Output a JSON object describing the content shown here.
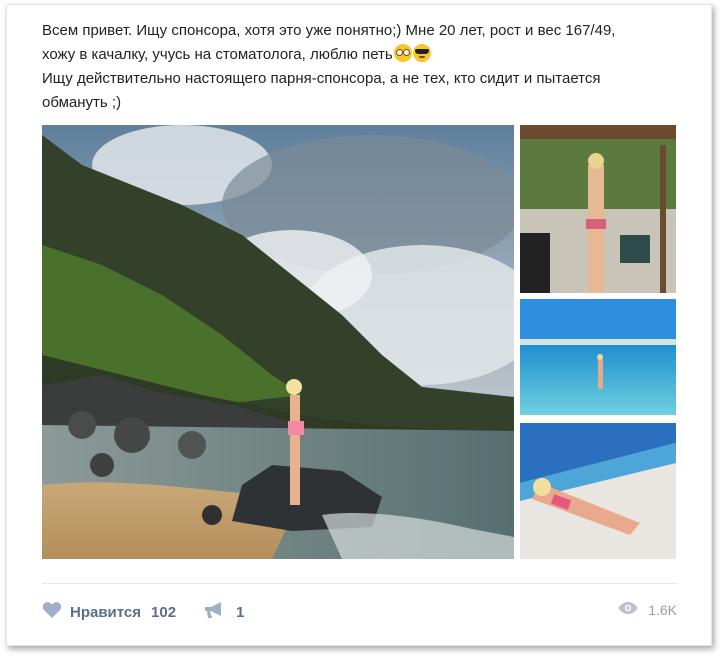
{
  "post": {
    "text_line1": "Всем привет. Ищу спонсора, хотя это уже понятно;) Мне 20 лет, рост и вес 167/49,",
    "text_line2": "хожу в качалку, учусь на стоматолога, люблю петь",
    "text_line3": "Ищу действительно настоящего парня-спонсора, а не тех, кто сидит и пытается",
    "text_line4": "обмануть ;)",
    "emojis": [
      "dizzy-face-emoji",
      "sunglasses-emoji"
    ]
  },
  "photos": [
    {
      "description": "beach-rocks-photo"
    },
    {
      "description": "terrace-photo"
    },
    {
      "description": "sea-photo"
    },
    {
      "description": "sunbathing-photo"
    }
  ],
  "actions": {
    "like_label": "Нравится",
    "like_count": "102",
    "share_count": "1",
    "views_count": "1.6K"
  },
  "colors": {
    "action_text": "#5b6e8a",
    "icon_gray": "#9fb0c6",
    "views_gray": "#939fad"
  }
}
